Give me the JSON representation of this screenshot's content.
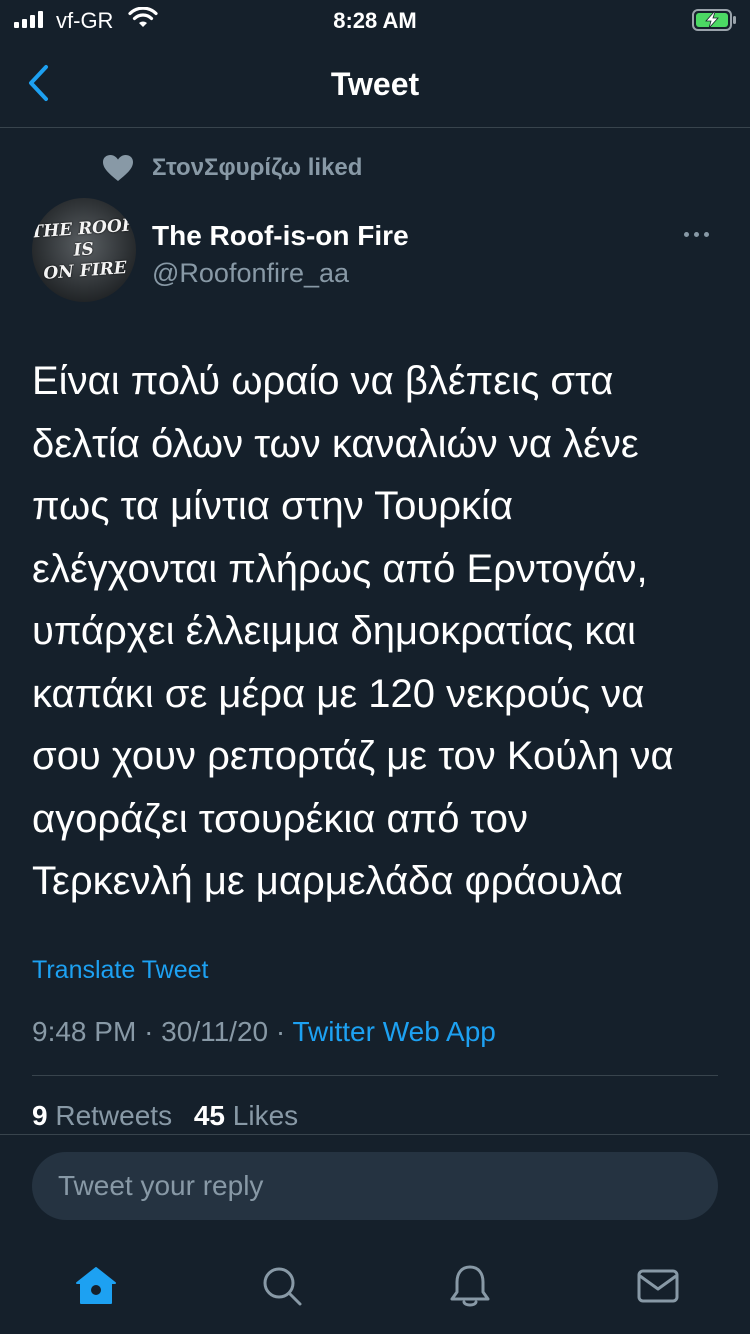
{
  "status_bar": {
    "carrier": "vf-GR",
    "time": "8:28 AM"
  },
  "nav": {
    "title": "Tweet",
    "back_icon": "chevron-left-icon"
  },
  "social_context": {
    "icon": "heart-icon",
    "text": "ΣτονΣφυρίζω liked"
  },
  "author": {
    "avatar_text": "THE ROOF\nIS\nON FIRE",
    "display_name": "The Roof-is-on Fire",
    "handle": "@Roofonfire_aa"
  },
  "tweet": {
    "text": "Είναι πολύ ωραίο να βλέπεις στα\nδελτία όλων των καναλιών να λένε\nπως τα μίντια στην Τουρκία\nελέγχονται πλήρως από Ερντογάν,\nυπάρχει έλλειμμα δημοκρατίας και\nκαπάκι σε μέρα με 120 νεκρούς να\nσου χουν ρεπορτάζ με τον Κούλη να\nαγοράζει τσουρέκια από τον\nΤερκενλή με μαρμελάδα φράουλα",
    "translate_label": "Translate Tweet",
    "time": "9:48 PM",
    "date": "30/11/20",
    "separator": "·",
    "source": "Twitter Web App"
  },
  "stats": {
    "retweets_count": "9",
    "retweets_label": "Retweets",
    "likes_count": "45",
    "likes_label": "Likes"
  },
  "reply": {
    "placeholder": "Tweet your reply"
  },
  "tabbar": [
    {
      "name": "home-icon",
      "active": true
    },
    {
      "name": "search-icon",
      "active": false
    },
    {
      "name": "bell-icon",
      "active": false
    },
    {
      "name": "mail-icon",
      "active": false
    }
  ],
  "colors": {
    "background": "#15202b",
    "accent": "#1da1f2",
    "secondary_text": "#8899a6",
    "divider": "#38444d",
    "battery": "#4cd964"
  }
}
